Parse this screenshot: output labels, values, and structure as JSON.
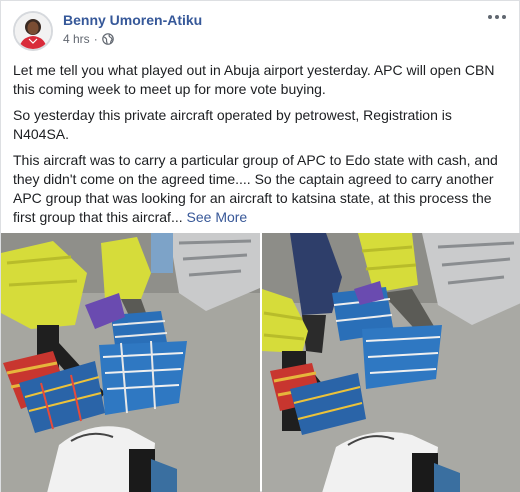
{
  "post": {
    "author": "Benny Umoren-Atiku",
    "timestamp": "4 hrs",
    "separator": "·",
    "visibility_icon": "globe-icon",
    "more_icon": "more-options-icon",
    "paragraphs": [
      "Let me tell you what played out in Abuja airport yesterday. APC will open CBN this coming week to meet up for more vote buying.",
      "So yesterday this private aircraft operated by petrowest, Registration is N404SA.",
      "This aircraft was to carry a particular group of APC to Edo state with cash, and they didn't come on the agreed time.... So the captain agreed to carry another APC group that was looking for an aircraft to katsina state, at this process the first group that this aircraf..."
    ],
    "see_more": "See More"
  },
  "colors": {
    "author_link": "#365899",
    "see_more_link": "#385898",
    "meta_text": "#616770",
    "vest": "#d6dc3a",
    "tarmac": "#a9a9a4"
  }
}
